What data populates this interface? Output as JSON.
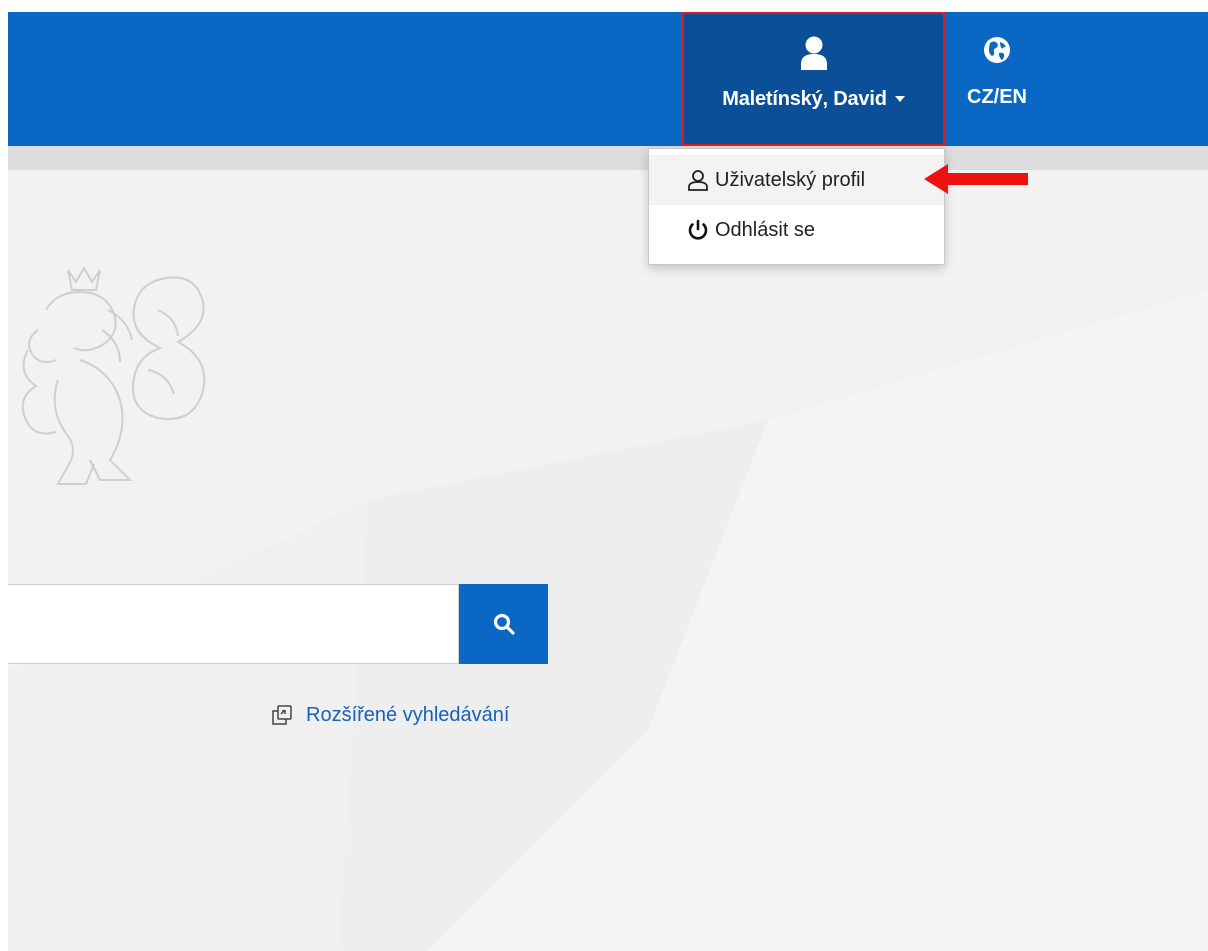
{
  "header": {
    "user_name": "Maletínský, David",
    "lang_label": "CZ/EN",
    "icons": {
      "user": "user-icon",
      "language": "globe-icon",
      "dropdown": "caret-down-icon"
    }
  },
  "user_dropdown": {
    "items": [
      {
        "label": "Uživatelský profil",
        "icon": "user-outline-icon"
      },
      {
        "label": "Odhlásit se",
        "icon": "power-icon"
      }
    ]
  },
  "search": {
    "placeholder": "",
    "value": "",
    "button_icon": "search-icon",
    "advanced_label": "Rozšířené vyhledávání",
    "advanced_icon": "copy-icon"
  },
  "colors": {
    "primary": "#0a67c4",
    "primary_dark": "#0a4f98",
    "highlight_border": "#e01b22",
    "link": "#1861b7",
    "annotation_arrow": "#ee1111"
  }
}
